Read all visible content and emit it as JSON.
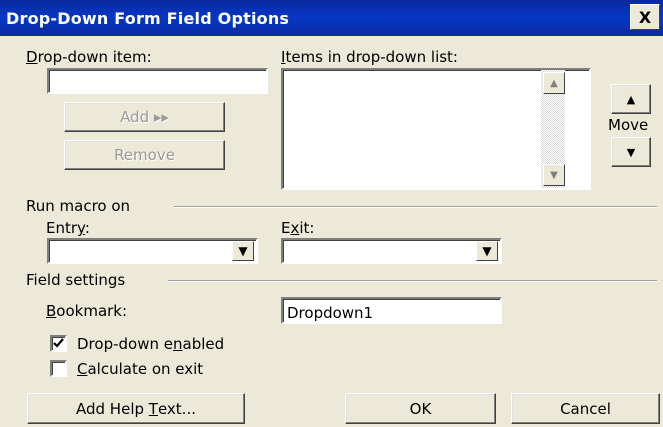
{
  "window": {
    "title": "Drop-Down Form Field Options",
    "close_glyph": "X"
  },
  "dropdown_item": {
    "label_underline": "D",
    "label_rest": "rop-down item:",
    "value": ""
  },
  "items_list": {
    "label_underline": "I",
    "label_rest": "tems in drop-down list:",
    "items": []
  },
  "buttons": {
    "add": "Add ▸▸",
    "remove": "Remove",
    "move_label": "Move",
    "move_up_glyph": "▲",
    "move_down_glyph": "▼"
  },
  "run_macro": {
    "heading": "Run macro on",
    "entry_prefix": "Entr",
    "entry_underline": "y",
    "entry_suffix": ":",
    "entry_value": "",
    "exit_prefix": "E",
    "exit_underline": "x",
    "exit_suffix": "it:",
    "exit_value": ""
  },
  "field_settings": {
    "heading": "Field settings",
    "bookmark_underline": "B",
    "bookmark_rest": "ookmark:",
    "bookmark_value": "Dropdown1",
    "enabled_prefix": "Drop-down e",
    "enabled_underline": "n",
    "enabled_suffix": "abled",
    "enabled_checked": true,
    "calc_underline": "C",
    "calc_rest": "alculate on exit",
    "calc_checked": false
  },
  "footer": {
    "help_prefix": "Add Help ",
    "help_underline": "T",
    "help_suffix": "ext...",
    "ok": "OK",
    "cancel": "Cancel"
  }
}
